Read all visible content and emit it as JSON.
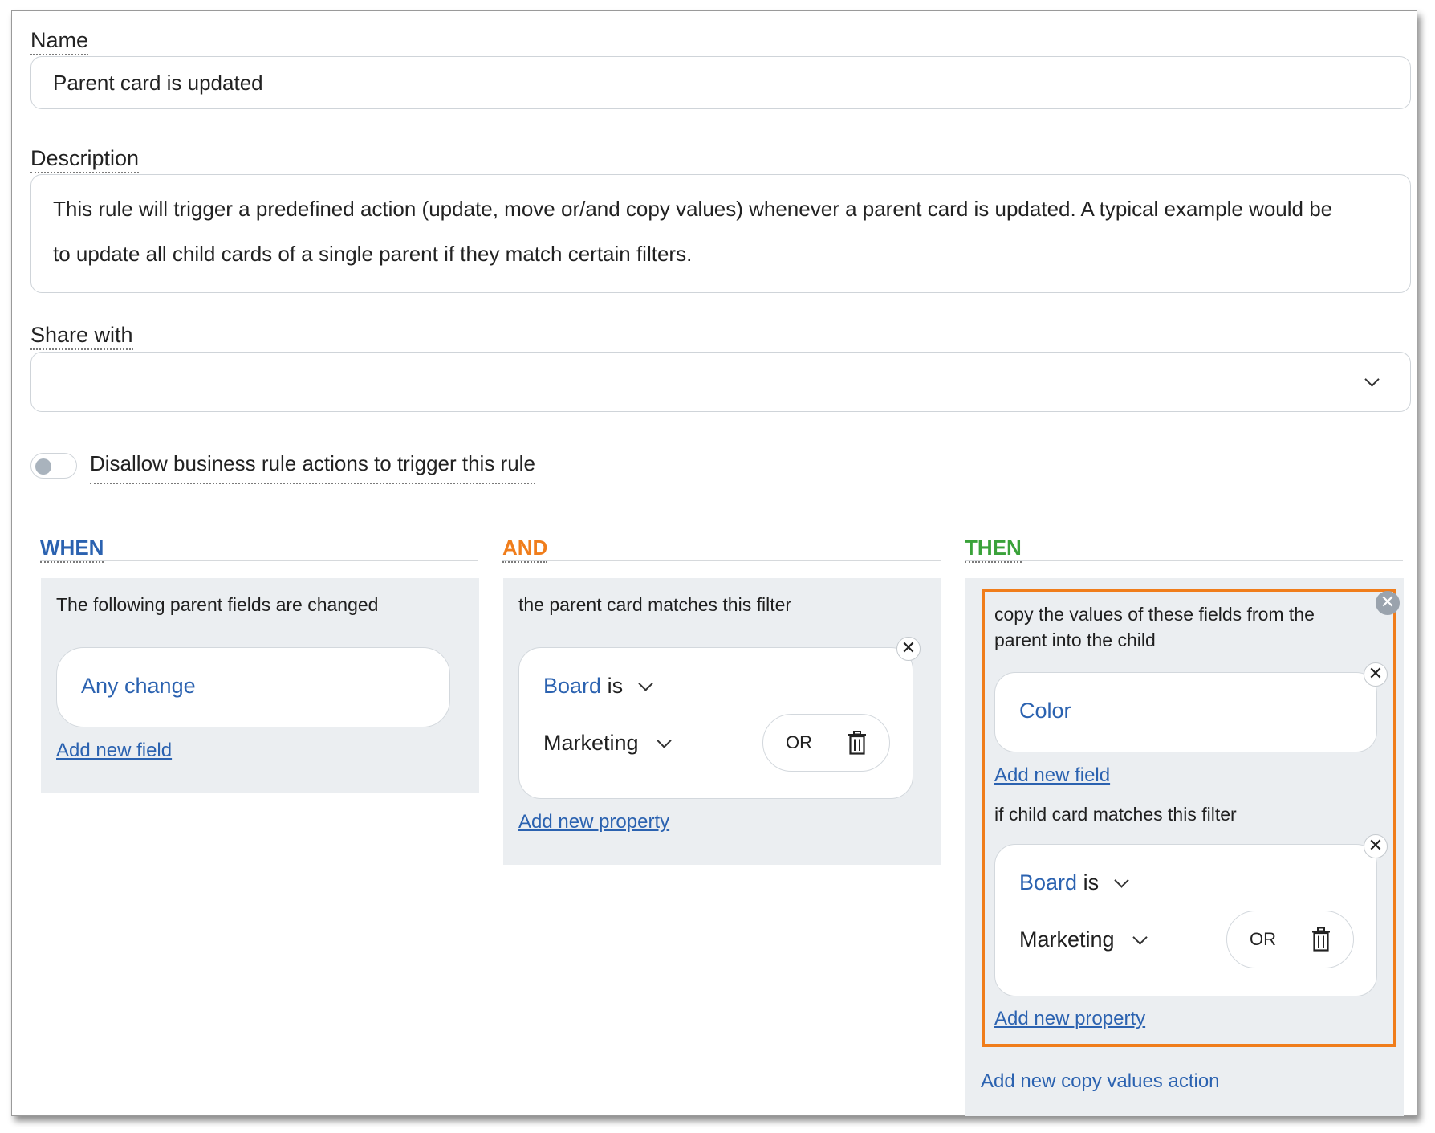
{
  "form": {
    "name_label": "Name",
    "name_value": "Parent card is updated",
    "description_label": "Description",
    "description_value": "This rule will trigger a predefined action (update, move or/and copy values) whenever a parent card is updated. A typical example would be to update all child cards of a single parent if they match certain filters.",
    "share_label": "Share with",
    "share_value": "",
    "toggle_label": "Disallow business rule actions to trigger this rule",
    "toggle_on": false
  },
  "columns": {
    "when": {
      "heading": "WHEN",
      "color": "#2b62b0",
      "title": "The following parent fields are changed",
      "field_value": "Any change",
      "add_link": "Add new field"
    },
    "and": {
      "heading": "AND",
      "color": "#f07d1b",
      "title": "the parent card matches this filter",
      "filter_property": "Board",
      "filter_operator": "is",
      "filter_value": "Marketing",
      "or_label": "OR",
      "add_link": "Add new property"
    },
    "then": {
      "heading": "THEN",
      "color": "#3aa23a",
      "title": "copy the values of these fields from the parent into the child",
      "field_value": "Color",
      "add_field_link": "Add new field",
      "child_filter_title": "if child card matches this filter",
      "filter_property": "Board",
      "filter_operator": "is",
      "filter_value": "Marketing",
      "or_label": "OR",
      "add_property_link": "Add new property",
      "add_action_link": "Add new copy values action"
    }
  },
  "icons": {
    "close": "close-icon",
    "chevron": "chevron-down-icon",
    "trash": "trash-icon"
  }
}
